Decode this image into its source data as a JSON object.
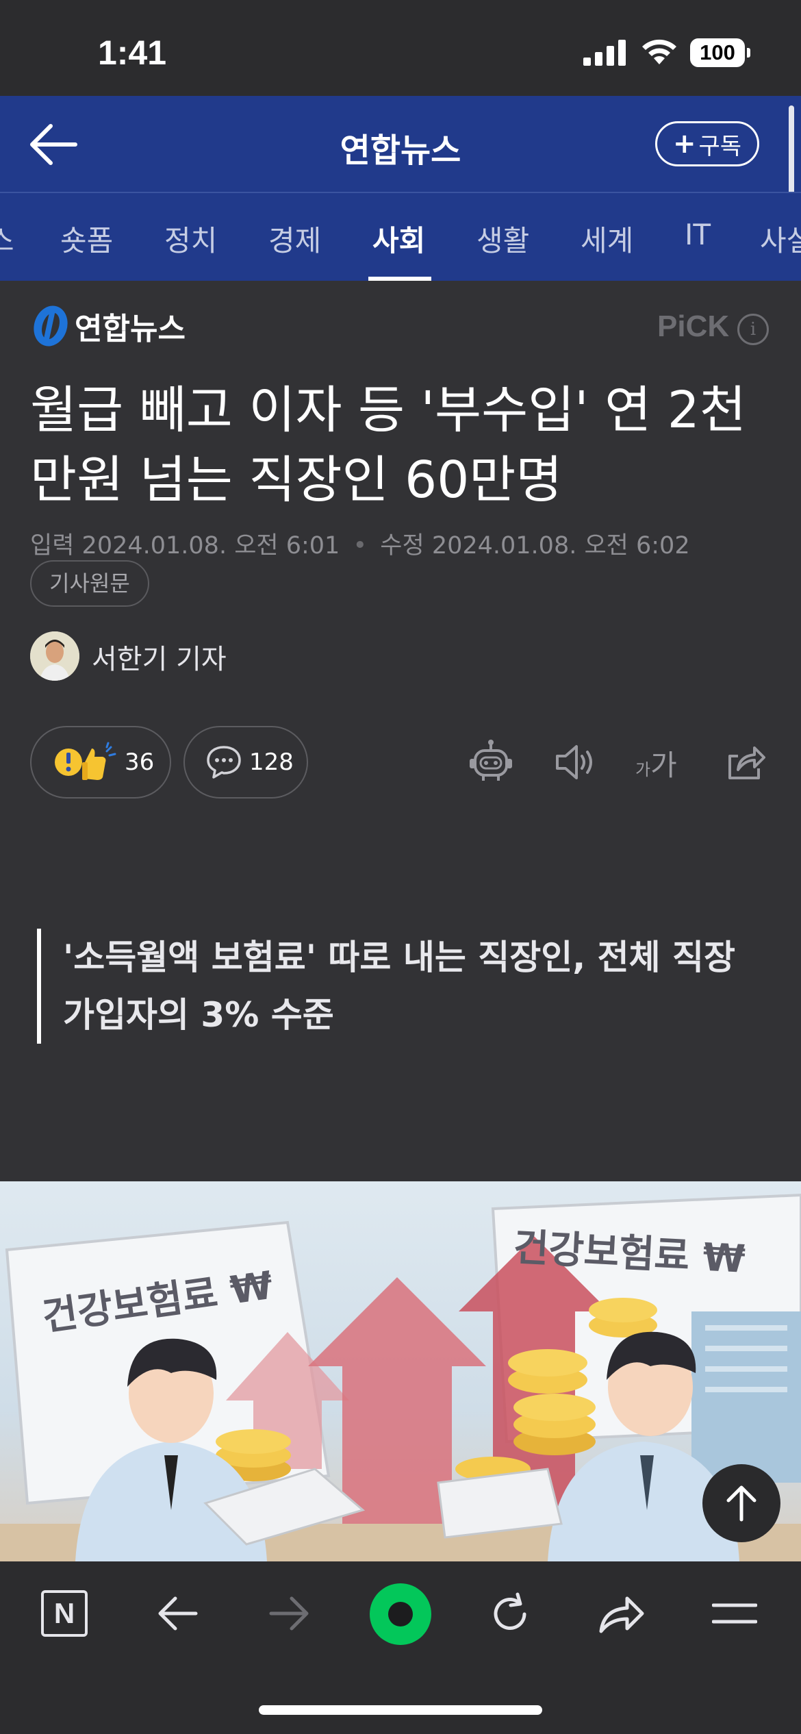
{
  "status_bar": {
    "time": "1:41",
    "battery": "100"
  },
  "header": {
    "title": "연합뉴스",
    "subscribe_label": "구독",
    "subscribe_plus": "+"
  },
  "tabs": {
    "items": [
      "스",
      "숏폼",
      "정치",
      "경제",
      "사회",
      "생활",
      "세계",
      "IT",
      "사설"
    ],
    "active": "사회"
  },
  "article": {
    "publisher": "연합뉴스",
    "pick_label": "PiCK",
    "info_glyph": "i",
    "headline": "월급 빼고 이자 등 '부수입' 연 2천만원 넘는 직장인 60만명",
    "date_input_label": "입력",
    "date_input": "2024.01.08. 오전 6:01",
    "date_separator": "•",
    "date_modified_label": "수정",
    "date_modified": "2024.01.08. 오전 6:02",
    "original_label": "기사원문",
    "reporter": "서한기 기자",
    "reaction_count": "36",
    "comment_count": "128",
    "font_size_icon_label_small": "가",
    "font_size_icon_label_large": "가",
    "summary_quote": "'소득월액 보험료' 따로 내는 직장인, 전체 직장 가입자의 3% 수준"
  },
  "image": {
    "caption_left": "건강보험료 ₩",
    "caption_right": "건강보험료 ₩"
  },
  "bottom_bar": {
    "home_label": "N"
  },
  "colors": {
    "header_bg": "#213a8b",
    "page_bg": "#323235",
    "accent_green": "#03c75a"
  }
}
